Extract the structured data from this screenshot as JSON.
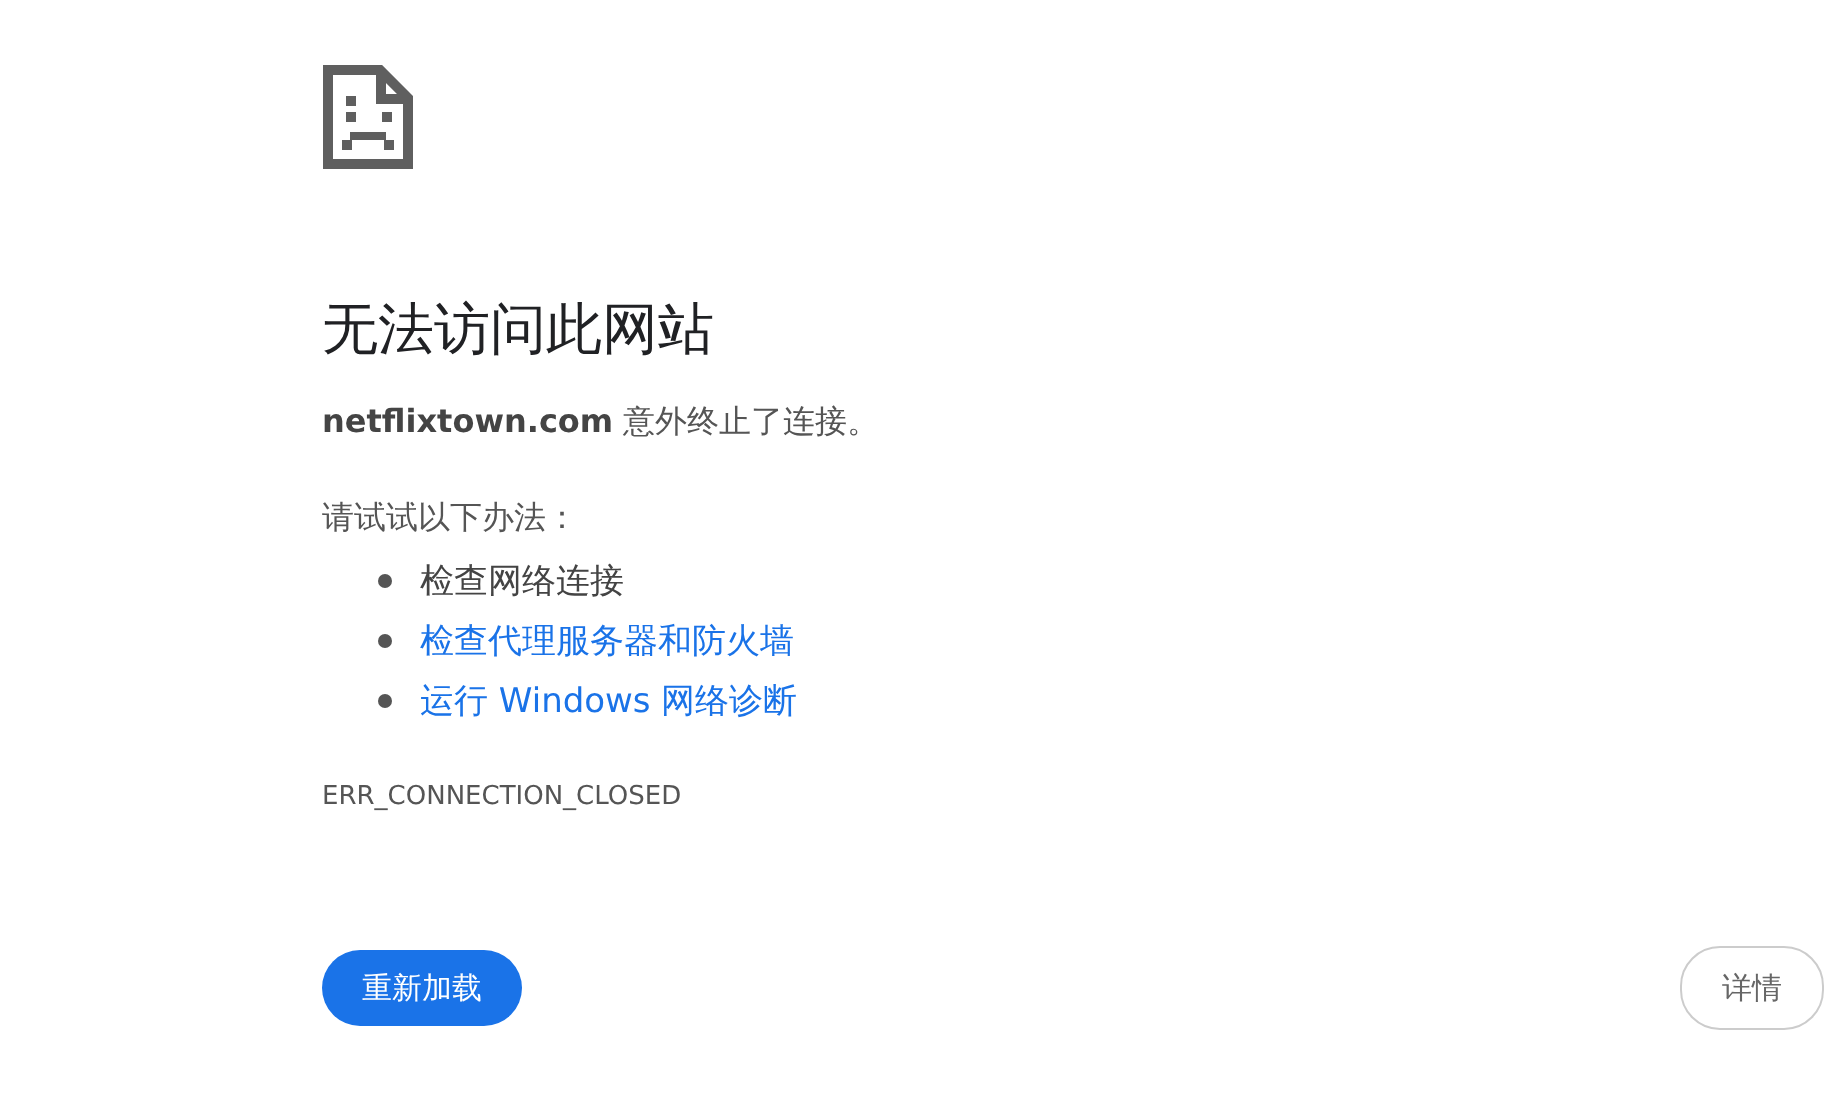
{
  "heading": "无法访问此网站",
  "message": {
    "domain": "netflixtown.com",
    "text": "意外终止了连接。"
  },
  "suggestions": {
    "title": "请试试以下办法：",
    "items": [
      {
        "kind": "text",
        "label": "检查网络连接"
      },
      {
        "kind": "link",
        "label": "检查代理服务器和防火墙"
      },
      {
        "kind": "link",
        "label": "运行 Windows 网络诊断"
      }
    ]
  },
  "error_code": "ERR_CONNECTION_CLOSED",
  "buttons": [
    {
      "kind": "primary",
      "label": "重新加载"
    },
    {
      "kind": "secondary",
      "label": "详情"
    }
  ]
}
